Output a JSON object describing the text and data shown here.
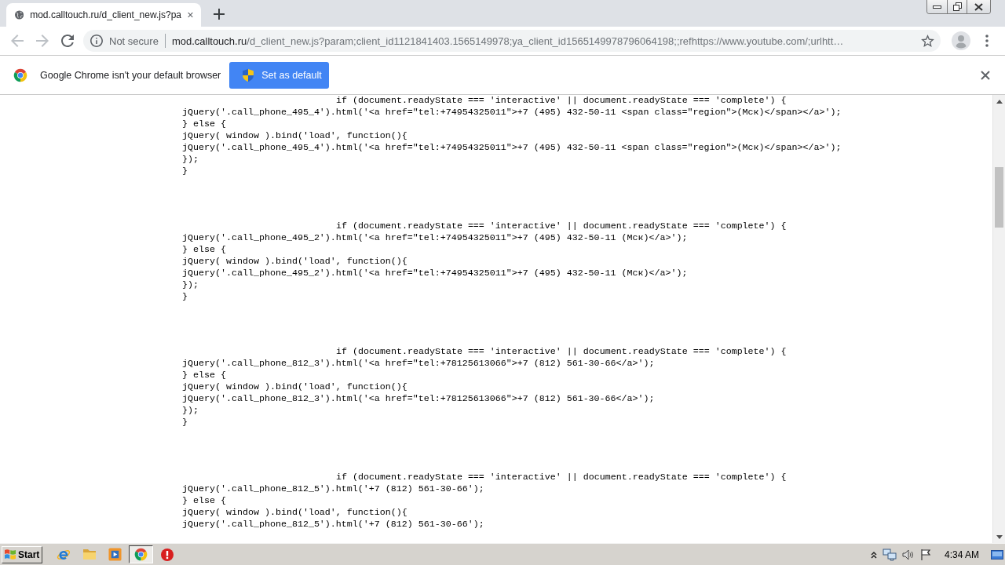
{
  "tabs": [
    {
      "title": "mod.calltouch.ru/d_client_new.js?pa",
      "selected": true
    }
  ],
  "toolbar": {
    "nav_buttons": [
      {
        "kind": "back",
        "disabled": true
      },
      {
        "kind": "forward",
        "disabled": true
      },
      {
        "kind": "reload",
        "disabled": false
      }
    ],
    "address_bar": {
      "security_label": "Not secure",
      "host": "mod.calltouch.ru",
      "path": "/d_client_new.js?param;client_id1121841403.1565149978;ya_client_id1565149978796064198;;refhttps://www.youtube.com/;urlhtt…"
    }
  },
  "infobar": {
    "message": "Google Chrome isn't your default browser",
    "button": "Set as default"
  },
  "code": {
    "blocks": [
      {
        "condition": "if (document.readyState === 'interactive' || document.readyState === 'complete') {",
        "lines": [
          "jQuery('.call_phone_495_4').html('<a href=\"tel:+74954325011\">+7 (495) 432-50-11 <span class=\"region\">(Мск)</span></a>');",
          "} else {",
          "jQuery( window ).bind('load', function(){",
          "jQuery('.call_phone_495_4').html('<a href=\"tel:+74954325011\">+7 (495) 432-50-11 <span class=\"region\">(Мск)</span></a>');",
          "});",
          "}"
        ]
      },
      {
        "condition": "if (document.readyState === 'interactive' || document.readyState === 'complete') {",
        "lines": [
          "jQuery('.call_phone_495_2').html('<a href=\"tel:+74954325011\">+7 (495) 432-50-11 (Мск)</a>');",
          "} else {",
          "jQuery( window ).bind('load', function(){",
          "jQuery('.call_phone_495_2').html('<a href=\"tel:+74954325011\">+7 (495) 432-50-11 (Мск)</a>');",
          "});",
          "}"
        ]
      },
      {
        "condition": "if (document.readyState === 'interactive' || document.readyState === 'complete') {",
        "lines": [
          "jQuery('.call_phone_812_3').html('<a href=\"tel:+78125613066\">+7 (812) 561-30-66</a>');",
          "} else {",
          "jQuery( window ).bind('load', function(){",
          "jQuery('.call_phone_812_3').html('<a href=\"tel:+78125613066\">+7 (812) 561-30-66</a>');",
          "});",
          "}"
        ]
      },
      {
        "condition": "if (document.readyState === 'interactive' || document.readyState === 'complete') {",
        "lines": [
          "jQuery('.call_phone_812_5').html('+7 (812) 561-30-66');",
          "} else {",
          "jQuery( window ).bind('load', function(){",
          "jQuery('.call_phone_812_5').html('+7 (812) 561-30-66');"
        ]
      }
    ]
  },
  "taskbar": {
    "start": "Start",
    "items": [
      {
        "kind": "ie",
        "selected": false
      },
      {
        "kind": "folder",
        "selected": false
      },
      {
        "kind": "media",
        "selected": false
      },
      {
        "kind": "chrome",
        "selected": true
      },
      {
        "kind": "alert",
        "selected": false
      }
    ],
    "clock": "4:34 AM"
  }
}
